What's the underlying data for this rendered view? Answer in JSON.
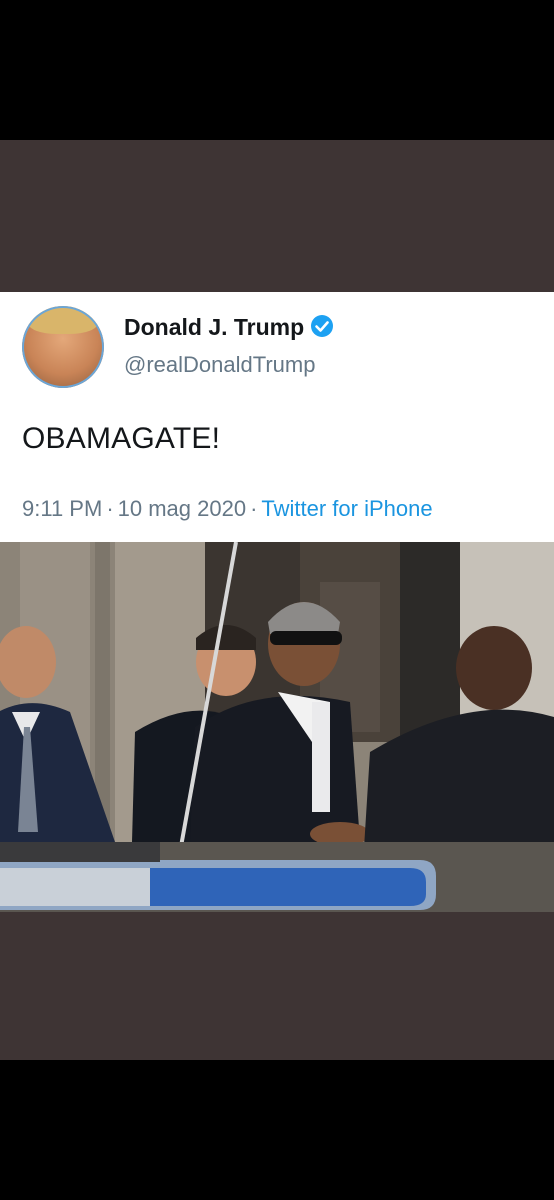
{
  "tweet": {
    "author_name": "Donald J. Trump",
    "author_handle": "@realDonaldTrump",
    "verified_icon": "verified-badge-icon",
    "text": "OBAMAGATE!",
    "time": "9:11 PM",
    "date": "10 mag 2020",
    "separator": "·",
    "source": "Twitter for iPhone"
  },
  "colors": {
    "name": "#14171a",
    "secondary": "#657786",
    "link": "#1b95e0",
    "verified": "#1da1f2",
    "frame_brown": "#3e3434"
  }
}
